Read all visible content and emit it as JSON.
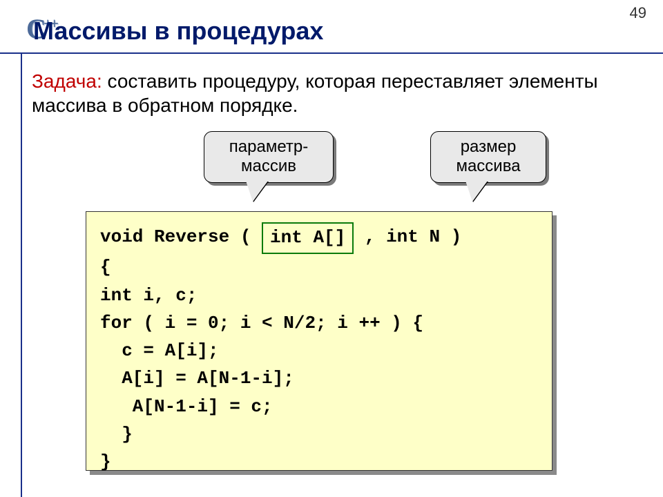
{
  "page_number": "49",
  "logo": {
    "main": "C",
    "plus": "++"
  },
  "title": "Массивы в процедурах",
  "task": {
    "label": "Задача:",
    "text": " составить процедуру, которая переставляет элементы массива в обратном порядке."
  },
  "callouts": {
    "param": {
      "line1": "параметр-",
      "line2": "массив"
    },
    "size": {
      "line1": "размер",
      "line2": "массива"
    }
  },
  "code": {
    "l1a": "void Reverse ( ",
    "l1_box": "int A[]",
    "l1b": " , int N )",
    "l2": "{",
    "l3": "int i, c;",
    "l4": "for ( i = 0; i < N/2; i ++ ) {",
    "l5": "  c = A[i];",
    "l6": "  A[i] = A[N-1-i];",
    "l7": "   A[N-1-i] = c;",
    "l8": "  }",
    "l9": "}"
  }
}
